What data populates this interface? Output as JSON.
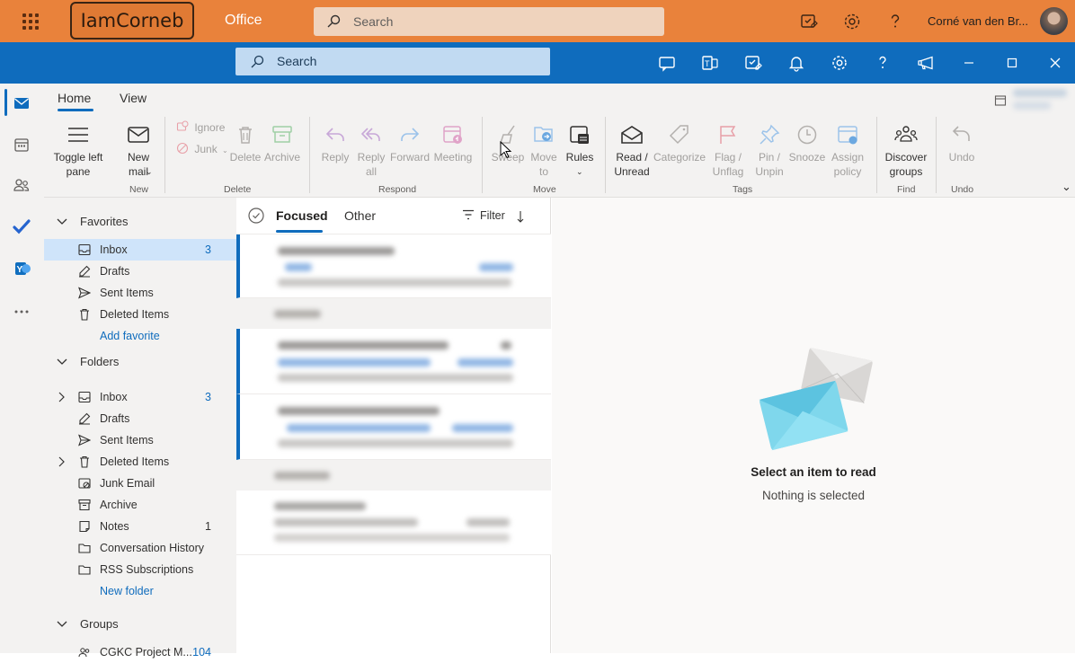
{
  "suite": {
    "brand_logo": "IamCorneb",
    "app_name": "Office",
    "search_placeholder": "Search",
    "user_name": "Corné van den Br...",
    "icons": [
      "app-launcher-icon",
      "feedback-icon",
      "settings-icon",
      "help-icon"
    ]
  },
  "outlook_bar": {
    "search_placeholder": "Search",
    "icons": [
      "my-day-icon",
      "teams-icon",
      "todo-icon",
      "notification-icon",
      "settings-icon",
      "help-icon",
      "announcement-icon"
    ],
    "window_controls": [
      "minimize",
      "maximize",
      "close"
    ]
  },
  "ribbon": {
    "tabs": [
      {
        "label": "Home",
        "active": true
      },
      {
        "label": "View",
        "active": false
      }
    ],
    "groups": {
      "new": {
        "label": "New",
        "toggle_left_pane": "Toggle left\npane",
        "new_mail": "New\nmail"
      },
      "delete": {
        "label": "Delete",
        "ignore": "Ignore",
        "junk": "Junk",
        "delete": "Delete",
        "archive": "Archive"
      },
      "respond": {
        "label": "Respond",
        "reply": "Reply",
        "reply_all": "Reply\nall",
        "forward": "Forward",
        "meeting": "Meeting"
      },
      "move": {
        "label": "Move",
        "sweep": "Sweep",
        "move_to": "Move\nto",
        "rules": "Rules"
      },
      "tags": {
        "label": "Tags",
        "read_unread": "Read /\nUnread",
        "categorize": "Categorize",
        "flag": "Flag /\nUnflag",
        "pin": "Pin /\nUnpin",
        "snooze": "Snooze",
        "assign_policy": "Assign\npolicy"
      },
      "find": {
        "label": "Find",
        "discover_groups": "Discover\ngroups"
      },
      "undo": {
        "label": "Undo",
        "undo": "Undo"
      }
    }
  },
  "nav": {
    "favorites_label": "Favorites",
    "favorites": [
      {
        "label": "Inbox",
        "count": "3",
        "selected": true,
        "icon": "inbox-icon"
      },
      {
        "label": "Drafts",
        "count": "",
        "icon": "drafts-icon"
      },
      {
        "label": "Sent Items",
        "count": "",
        "icon": "sent-icon"
      },
      {
        "label": "Deleted Items",
        "count": "",
        "icon": "trash-icon"
      }
    ],
    "add_favorite": "Add favorite",
    "folders_label": "Folders",
    "folders": [
      {
        "label": "Inbox",
        "count": "3",
        "icon": "inbox-icon",
        "expandable": true
      },
      {
        "label": "Drafts",
        "count": "",
        "icon": "drafts-icon"
      },
      {
        "label": "Sent Items",
        "count": "",
        "icon": "sent-icon"
      },
      {
        "label": "Deleted Items",
        "count": "",
        "icon": "trash-icon",
        "expandable": true
      },
      {
        "label": "Junk Email",
        "count": "",
        "icon": "junk-icon"
      },
      {
        "label": "Archive",
        "count": "",
        "icon": "archive-icon"
      },
      {
        "label": "Notes",
        "count": "1",
        "icon": "notes-icon"
      },
      {
        "label": "Conversation History",
        "count": "",
        "icon": "folder-icon"
      },
      {
        "label": "RSS Subscriptions",
        "count": "",
        "icon": "folder-icon"
      }
    ],
    "new_folder": "New folder",
    "groups_label": "Groups",
    "groups": [
      {
        "label": "CGKC Project M...",
        "count": "104"
      }
    ]
  },
  "message_list": {
    "tabs": [
      {
        "label": "Focused",
        "active": true
      },
      {
        "label": "Other",
        "active": false
      }
    ],
    "filter_label": "Filter"
  },
  "reading_pane": {
    "title": "Select an item to read",
    "subtitle": "Nothing is selected"
  },
  "colors": {
    "suite_bar": "#e9823b",
    "app_bar": "#0f6cbd",
    "accent": "#0f6cbd",
    "selected": "#cfe4fa"
  }
}
